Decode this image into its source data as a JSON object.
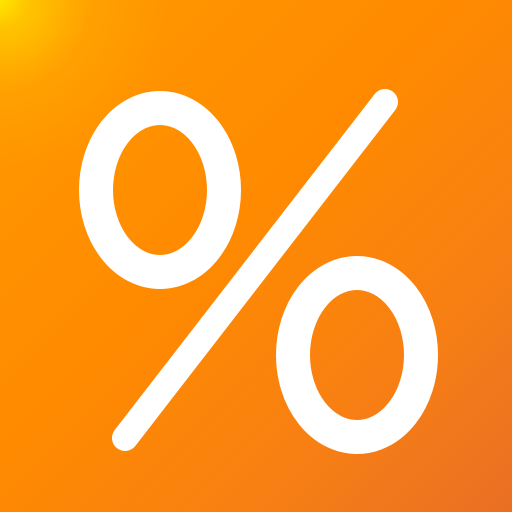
{
  "app_icon": {
    "symbol": "%",
    "icon_name": "percent-icon",
    "colors": {
      "background": "#ff8a00",
      "highlight": "#ffe600",
      "glyph": "#ffffff"
    }
  }
}
